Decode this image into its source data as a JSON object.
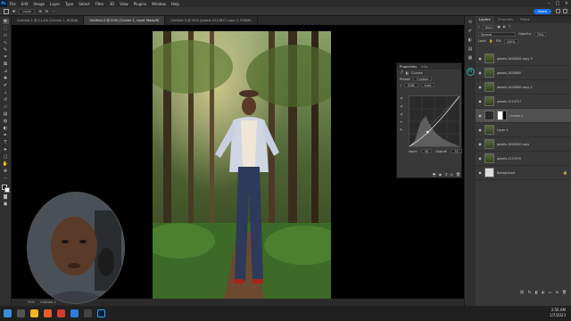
{
  "menubar": {
    "logo": "Ps",
    "items": [
      "File",
      "Edit",
      "Image",
      "Layer",
      "Type",
      "Select",
      "Filter",
      "3D",
      "View",
      "Plugins",
      "Window",
      "Help"
    ]
  },
  "options": {
    "mode": "Layer",
    "share_label": "Share"
  },
  "tabs": [
    "Untitled-1 @ 11.4% (Curves 1, RGB/8)",
    "Untitled-2 @ 50% (Curves 1, Layer Mask/8)",
    "Untitled-3 @ 50% (jewels 2213827 copy 2, RGB/8)"
  ],
  "status": {
    "zoom": "50%",
    "doc": "Untitled-2"
  },
  "properties": {
    "tab_active": "Properties",
    "tab_other": "Info",
    "subtitle": "Curves",
    "preset_label": "Preset:",
    "preset_value": "Custom",
    "channel_value": "RGB",
    "auto_label": "Auto",
    "input_label": "Input:",
    "input_value": "93",
    "output_label": "Output:",
    "output_value": "75"
  },
  "layers_panel": {
    "tabs": [
      "Layers",
      "Channels",
      "Paths"
    ],
    "filter_label": "Kind",
    "blend_mode": "Normal",
    "opacity_label": "Opacity:",
    "opacity_value": "75%",
    "lock_label": "Lock:",
    "fill_label": "Fill:",
    "fill_value": "100%",
    "layers": [
      {
        "name": "pexels-1428000 copy 3",
        "selected": false
      },
      {
        "name": "pexels-1428000",
        "selected": false
      },
      {
        "name": "pexels-1428000 copy 2",
        "selected": false
      },
      {
        "name": "pexels-1213717",
        "selected": false
      },
      {
        "name": "Curves 1",
        "selected": true
      },
      {
        "name": "Layer 1",
        "selected": false
      },
      {
        "name": "pexels-1428000 copy",
        "selected": false
      },
      {
        "name": "pexels-1172970",
        "selected": false
      },
      {
        "name": "Background",
        "selected": false
      }
    ]
  },
  "taskbar": {
    "time": "3:56 AM",
    "date": "1/7/2023"
  },
  "colors": {
    "accent": "#1473e6",
    "panel": "#383838",
    "selected_layer": "#505050"
  }
}
